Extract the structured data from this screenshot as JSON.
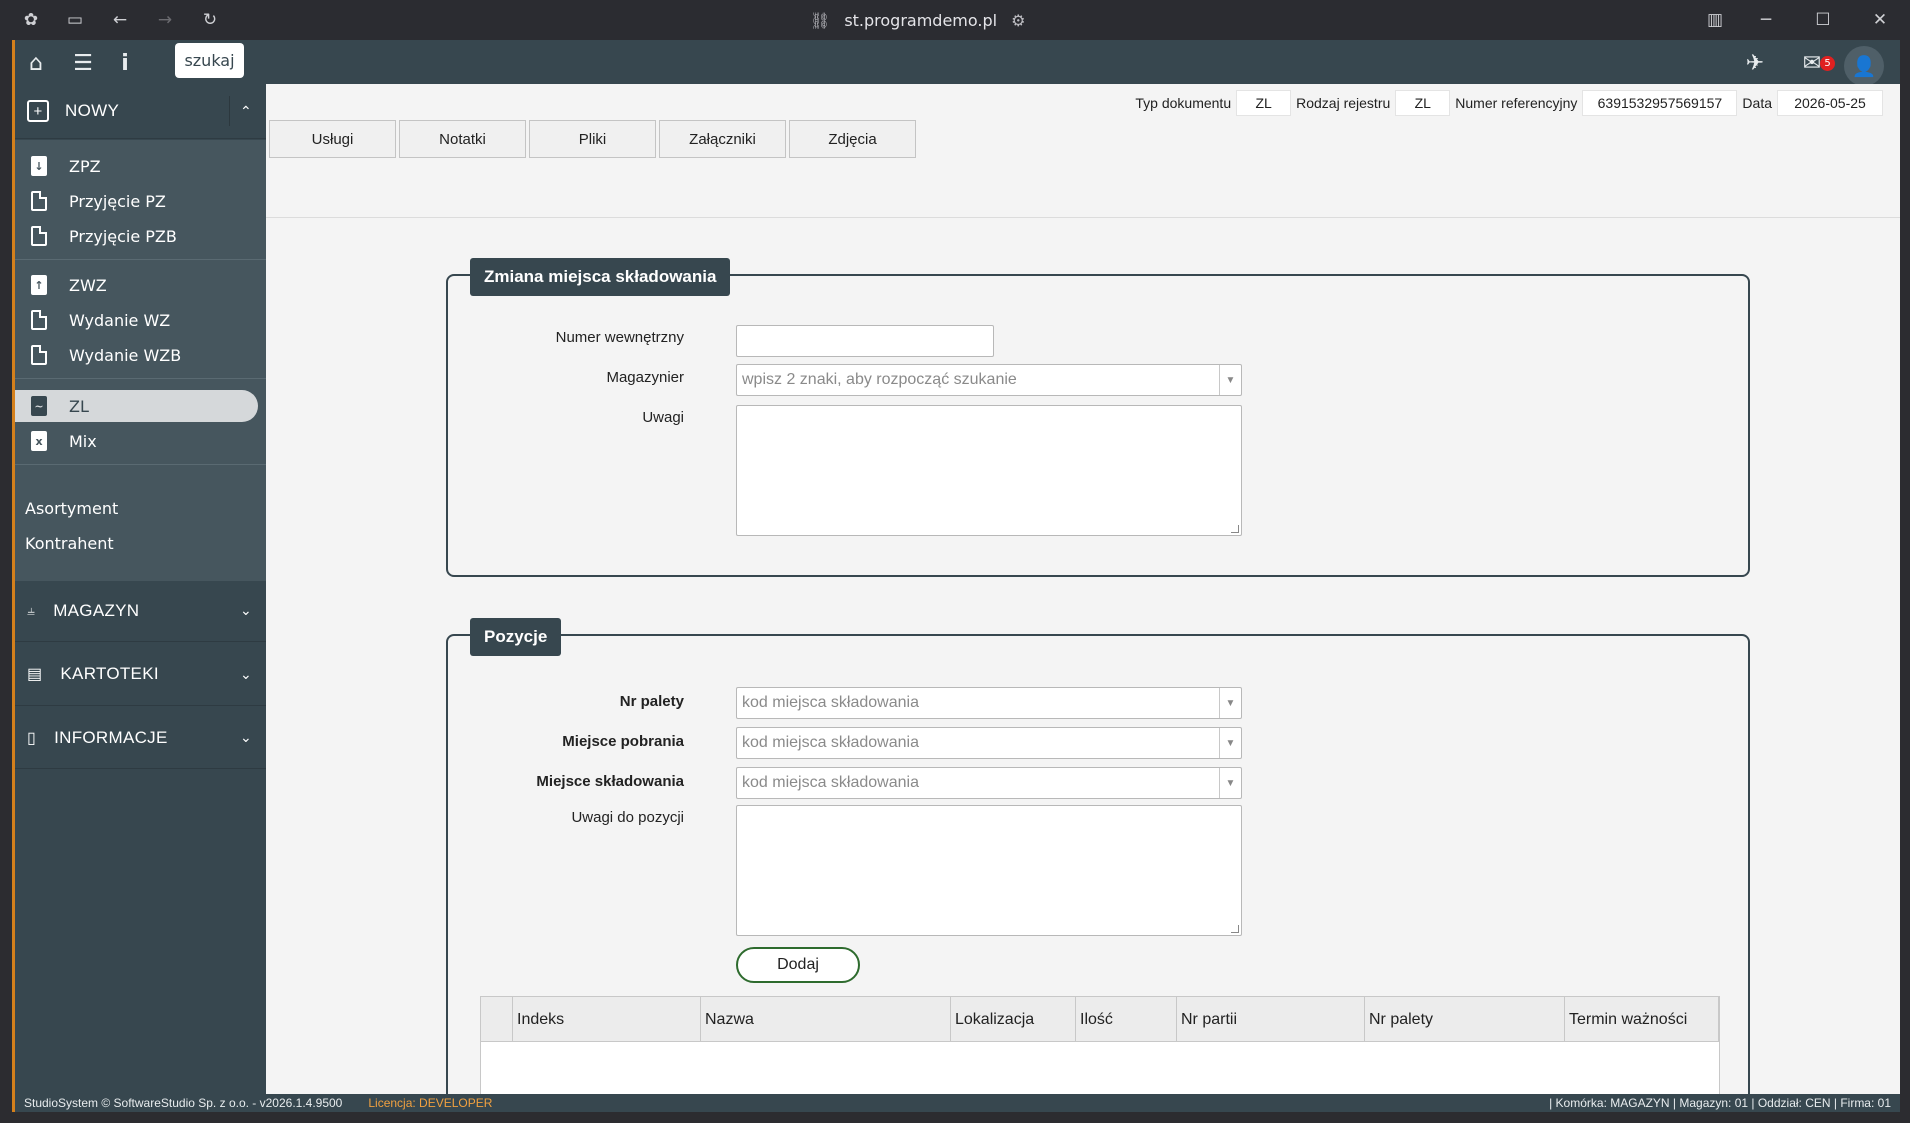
{
  "browser": {
    "url": "st.programdemo.pl"
  },
  "topbar": {
    "search_label": "szukaj",
    "mail_count": "5"
  },
  "sidebar": {
    "new_header": "NOWY",
    "group1": [
      "ZPZ",
      "Przyjęcie PZ",
      "Przyjęcie PZB"
    ],
    "group2": [
      "ZWZ",
      "Wydanie WZ",
      "Wydanie WZB"
    ],
    "group3": [
      "ZL",
      "Mix"
    ],
    "group4": [
      "Asortyment",
      "Kontrahent"
    ],
    "magazyn": "MAGAZYN",
    "kartoteki": "KARTOTEKI",
    "informacje": "INFORMACJE"
  },
  "tabs": [
    "Usługi",
    "Notatki",
    "Pliki",
    "Załączniki",
    "Zdjęcia"
  ],
  "meta": {
    "typ_label": "Typ dokumentu",
    "typ_value": "ZL",
    "rodzaj_label": "Rodzaj rejestru",
    "rodzaj_value": "ZL",
    "numer_label": "Numer referencyjny",
    "numer_value": "6391532957569157",
    "data_label": "Data",
    "data_value": "2026-05-25"
  },
  "form1": {
    "legend": "Zmiana miejsca składowania",
    "numer_label": "Numer wewnętrzny",
    "magazynier_label": "Magazynier",
    "magazynier_placeholder": "wpisz 2 znaki, aby rozpocząć szukanie",
    "uwagi_label": "Uwagi"
  },
  "form2": {
    "legend": "Pozycje",
    "nr_palety_label": "Nr palety",
    "nr_palety_placeholder": "kod miejsca składowania",
    "miejsce_pobrania_label": "Miejsce pobrania",
    "miejsce_pobrania_placeholder": "kod miejsca składowania",
    "miejsce_skladowania_label": "Miejsce składowania",
    "miejsce_skladowania_placeholder": "kod miejsca składowania",
    "uwagi_label": "Uwagi do pozycji",
    "add_label": "Dodaj"
  },
  "grid": {
    "columns": [
      "Indeks",
      "Nazwa",
      "Lokalizacja",
      "Ilość",
      "Nr partii",
      "Nr palety",
      "Termin ważności"
    ]
  },
  "status": {
    "left": "StudioSystem © SoftwareStudio Sp. z o.o. - v2026.1.4.9500",
    "license": "Licencja: DEVELOPER",
    "right": "| Komórka: MAGAZYN | Magazyn: 01 | Oddział: CEN | Firma: 01"
  }
}
